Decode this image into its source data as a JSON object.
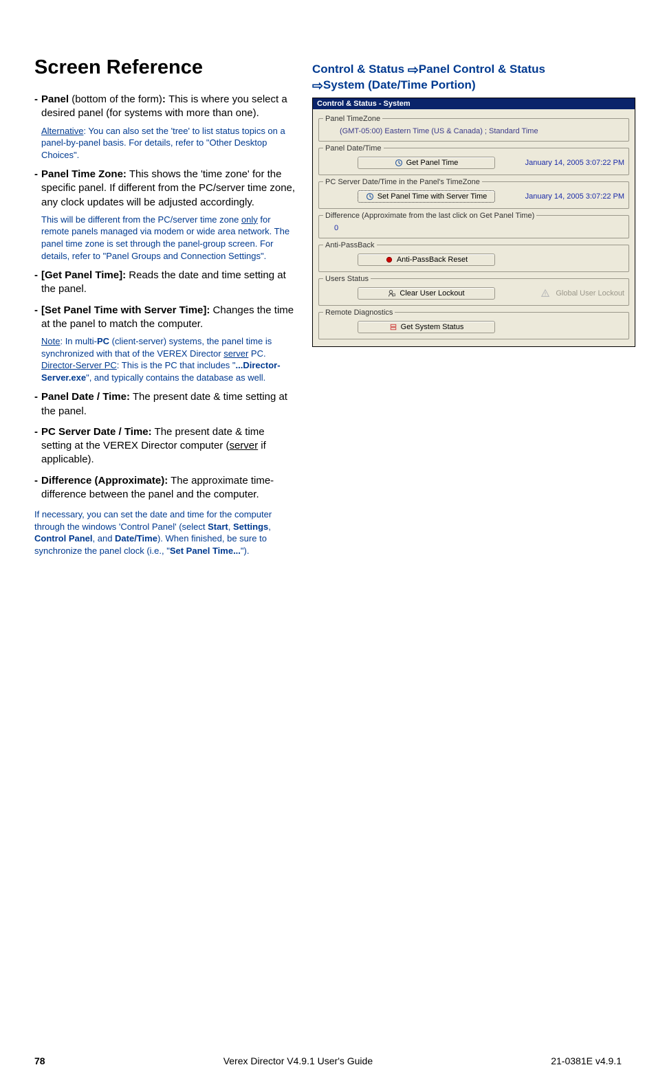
{
  "left": {
    "h1": "Screen Reference",
    "panel_item_b_prefix": "-",
    "panel_item_b_label": "Panel",
    "panel_item_b_paren": " (bottom of the form)",
    "panel_item_b_colon": ": ",
    "panel_item_body": "This is where you select a desired panel (for systems with more than one).",
    "alt_note_prefix": "Alternative",
    "alt_note_body": ":  You can also set the 'tree' to list status topics on a panel-by-panel basis.  For details, refer to \"Other Desktop Choices\".",
    "ptz_label": "Panel Time Zone:",
    "ptz_body": " This shows the 'time zone' for the specific panel.  If different from the PC/server time zone, any clock updates will be adjusted accordingly.",
    "ptz_note_1": "This will be different from the PC/server time zone ",
    "ptz_note_only": "only",
    "ptz_note_2": " for remote panels managed via modem or wide area network.  The panel time zone is set through the panel-group screen.  For details, refer to \"Panel Groups and Connection Settings\".",
    "gpt_label": "[Get Panel Time]:",
    "gpt_body": " Reads the date and time setting at the panel.",
    "spt_label": "[Set Panel Time with Server Time]:",
    "spt_body": " Changes the time at the panel to match the computer.",
    "multi_note_prefix": "Note",
    "multi_note_1": ":  In multi-",
    "multi_note_pc": "PC",
    "multi_note_2": " (client-server) systems, the panel time is synchronized with that of the VEREX Director ",
    "multi_note_server": "server",
    "multi_note_3": " PC.  ",
    "multi_note_dsp": "Director-Server PC",
    "multi_note_4": ":  This is the PC that includes \"",
    "multi_note_exe": "...Director-Server.exe",
    "multi_note_5": "\", and typically contains the database as well.",
    "pdt_label": "Panel Date / Time:",
    "pdt_body": " The present date & time setting at the panel.",
    "psd_label": "PC Server Date / Time:",
    "psd_body": " The present date & time setting at the VEREX Director computer (",
    "psd_server": "server",
    "psd_body2": " if applicable).",
    "diff_label": "Difference (Approximate):",
    "diff_body": " The approximate time-difference between the panel and the computer.",
    "final_note_1": "If necessary, you can set the date and time for the computer through the windows 'Control Panel' (select ",
    "final_start": "Start",
    "final_c1": ", ",
    "final_settings": "Settings",
    "final_c2": ", ",
    "final_cp": "Control Panel",
    "final_c3": ", and ",
    "final_dt": "Date/Time",
    "final_2": "). When finished, be sure to synchronize the panel clock (i.e., \"",
    "final_spt": "Set Panel Time...",
    "final_3": "\")."
  },
  "right_heading": {
    "p1": "Control & Status ",
    "p2": "Panel Control & Status ",
    "p3": "System (Date/Time Portion)"
  },
  "panel": {
    "title": "Control & Status - System",
    "tz_legend": "Panel TimeZone",
    "tz_value": "(GMT-05:00) Eastern Time (US & Canada) ; Standard Time",
    "dt_legend": "Panel Date/Time",
    "btn_get_panel_time": "Get Panel Time",
    "dt_value1": "January 14, 2005 3:07:22 PM",
    "pcs_legend": "PC Server Date/Time in the Panel's TimeZone",
    "btn_set_panel_time": "Set Panel Time with Server Time",
    "dt_value2": "January 14, 2005 3:07:22 PM",
    "diff_legend": "Difference (Approximate from the last click on Get Panel Time)",
    "diff_value": "0",
    "apb_legend": "Anti-PassBack",
    "btn_apb_reset": "Anti-PassBack Reset",
    "users_legend": "Users Status",
    "btn_clear_lockout": "Clear User Lockout",
    "global_lockout": "Global User Lockout",
    "rd_legend": "Remote Diagnostics",
    "btn_get_status": "Get System Status"
  },
  "footer": {
    "page": "78",
    "center": "Verex Director V4.9.1 User's Guide",
    "right": "21-0381E v4.9.1"
  }
}
